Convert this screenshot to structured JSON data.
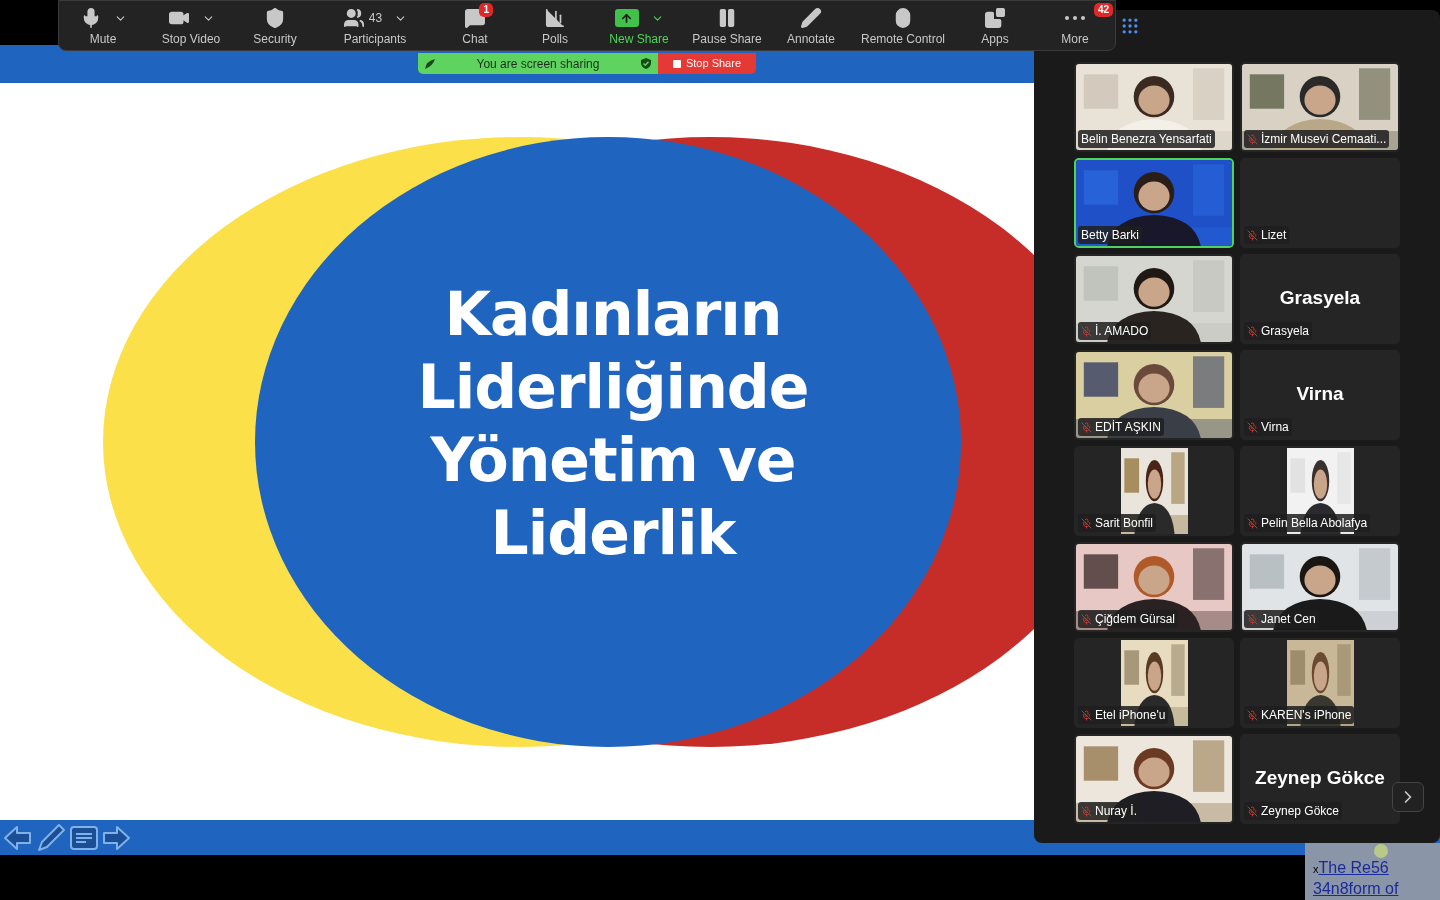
{
  "toolbar": {
    "items": [
      {
        "kind": "mic",
        "label": "Mute",
        "caret": true
      },
      {
        "kind": "video",
        "label": "Stop Video",
        "caret": true
      },
      {
        "kind": "security",
        "label": "Security",
        "caret": false
      },
      {
        "kind": "participants",
        "label": "Participants",
        "count": "43",
        "caret": true
      },
      {
        "kind": "chat",
        "label": "Chat",
        "badge": "1",
        "caret": false
      },
      {
        "kind": "polls",
        "label": "Polls",
        "caret": false
      },
      {
        "kind": "share",
        "label": "New Share",
        "caret": true,
        "highlighted": true
      },
      {
        "kind": "pause",
        "label": "Pause Share",
        "caret": false
      },
      {
        "kind": "annotate",
        "label": "Annotate",
        "caret": false
      },
      {
        "kind": "remote",
        "label": "Remote Control",
        "caret": false
      },
      {
        "kind": "apps",
        "label": "Apps",
        "caret": false
      },
      {
        "kind": "more",
        "label": "More",
        "badge": "42",
        "caret": false
      }
    ]
  },
  "sharing_bar": {
    "status": "You are screen sharing",
    "stop_button": "Stop Share"
  },
  "slide": {
    "title_lines": [
      "Kadınların",
      "Liderliğinde",
      "Yönetim ve",
      "Liderlik"
    ]
  },
  "gallery": {
    "tiles": [
      {
        "kind": "video",
        "name": "Belin Benezra Yensarfati",
        "muted": false,
        "speaking": false
      },
      {
        "kind": "video",
        "name": "İzmir Musevi Cemaati...",
        "muted": true,
        "speaking": false
      },
      {
        "kind": "video",
        "name": "Betty Barki",
        "muted": false,
        "speaking": true
      },
      {
        "kind": "blank",
        "name": "Lizet",
        "muted": true,
        "speaking": false
      },
      {
        "kind": "video",
        "name": "İ. AMADO",
        "muted": true,
        "speaking": false
      },
      {
        "kind": "name",
        "name": "Grasyela",
        "display_name": "Grasyela",
        "muted": true,
        "speaking": false
      },
      {
        "kind": "video",
        "name": "EDİT AŞKIN",
        "muted": true,
        "speaking": false
      },
      {
        "kind": "name",
        "name": "Virna",
        "display_name": "Virna",
        "muted": true,
        "speaking": false
      },
      {
        "kind": "narrow",
        "name": "Sarit Bonfil",
        "muted": true,
        "speaking": false
      },
      {
        "kind": "narrow",
        "name": "Pelin Bella Abolafya",
        "muted": true,
        "speaking": false
      },
      {
        "kind": "video",
        "name": "Çiğdem Gürsal",
        "muted": true,
        "speaking": false
      },
      {
        "kind": "video",
        "name": "Janet Cen",
        "muted": true,
        "speaking": false
      },
      {
        "kind": "narrow",
        "name": "Etel iPhone'u",
        "muted": true,
        "speaking": false
      },
      {
        "kind": "narrow",
        "name": "KAREN's iPhone",
        "muted": true,
        "speaking": false
      },
      {
        "kind": "video",
        "name": "Nuray İ.",
        "muted": true,
        "speaking": false
      },
      {
        "kind": "name",
        "name": "Zeynep Gökce",
        "display_name": "Zeynep Gökce",
        "muted": true,
        "speaking": false
      }
    ]
  },
  "corner_note": {
    "prefix": "x",
    "link_lines": [
      "The Re56",
      "34n8form of"
    ]
  }
}
